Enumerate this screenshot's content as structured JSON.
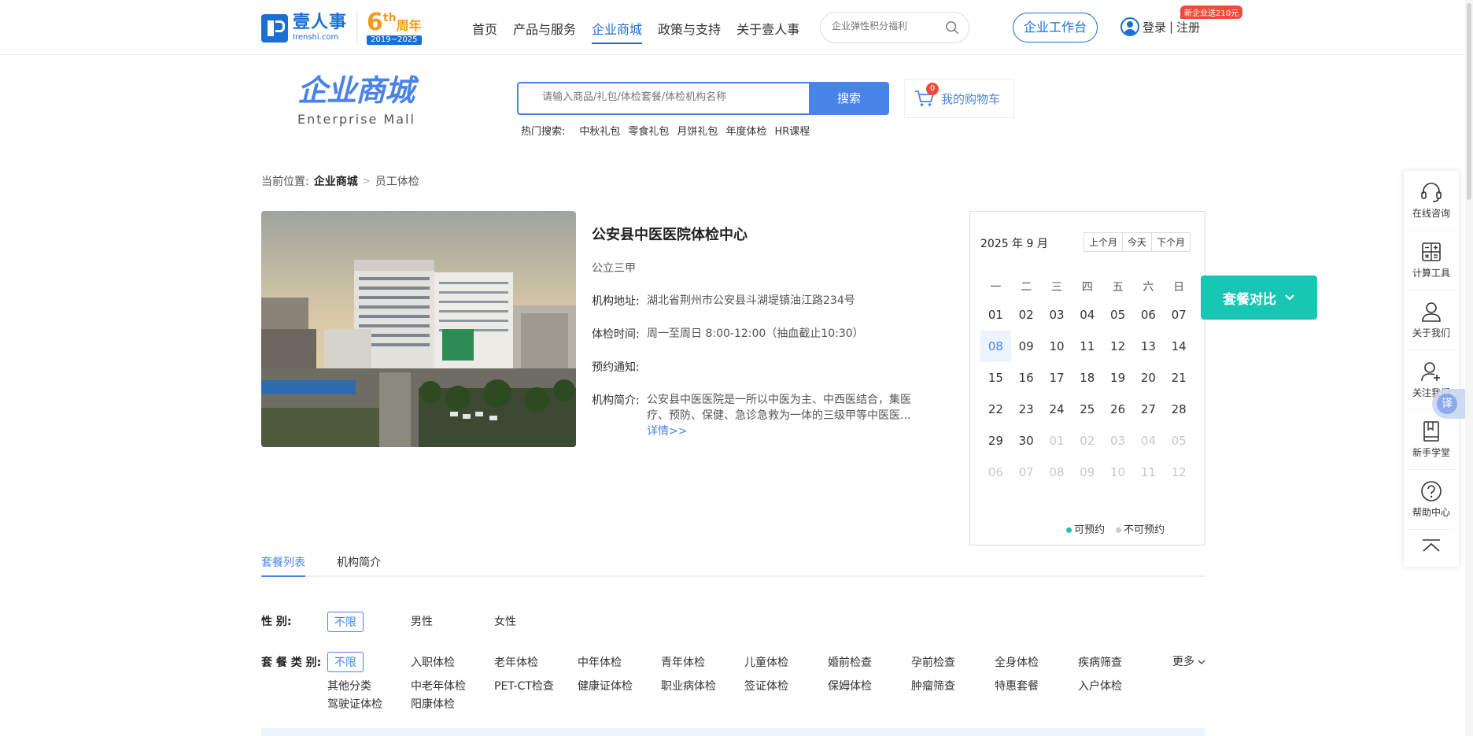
{
  "nav": {
    "logo_cn": "壹人事",
    "logo_en": "Irenshi.com",
    "anniv_big": "6",
    "anniv_sup": "th",
    "anniv_cn": "周年",
    "anniv_years": "2019~2025",
    "items": [
      "首页",
      "产品与服务",
      "企业商城",
      "政策与支持",
      "关于壹人事"
    ],
    "active_item": "企业商城",
    "search_placeholder": "企业弹性积分福利",
    "workbench": "企业工作台",
    "login": "登录",
    "divider": "|",
    "register": "注册",
    "promo": "新企业送210元"
  },
  "mall": {
    "title_cn": "企业商城",
    "title_en": "Enterprise  Mall",
    "search_placeholder": "请输入商品/礼包/体检套餐/体检机构名称",
    "search_button": "搜索",
    "hot_label": "热门搜索:",
    "hot_items": [
      "中秋礼包",
      "零食礼包",
      "月饼礼包",
      "年度体检",
      "HR课程"
    ],
    "cart_label": "我的购物车",
    "cart_count": "0"
  },
  "breadcrumb": {
    "prefix": "当前位置:",
    "level1": "企业商城",
    "sep": ">",
    "level2": "员工体检"
  },
  "institution": {
    "name": "公安县中医医院体检中心",
    "grade": "公立三甲",
    "address_label": "机构地址:",
    "address": "湖北省荆州市公安县斗湖堤镇油江路234号",
    "hours_label": "体检时间:",
    "hours": "周一至周日 8:00-12:00（抽血截止10:30）",
    "notice_label": "预约通知:",
    "notice": "",
    "intro_label": "机构简介:",
    "intro": "公安县中医医院是一所以中医为主、中西医结合，集医疗、预防、保健、急诊急救为一体的三级甲等中医医...",
    "detail_link": "详情>>"
  },
  "calendar": {
    "month_label": "2025 年 9 月",
    "prev": "上个月",
    "today": "今天",
    "next": "下个月",
    "weekdays": [
      "一",
      "二",
      "三",
      "四",
      "五",
      "六",
      "日"
    ],
    "weeks": [
      [
        "01",
        "02",
        "03",
        "04",
        "05",
        "06",
        "07"
      ],
      [
        "08",
        "09",
        "10",
        "11",
        "12",
        "13",
        "14"
      ],
      [
        "15",
        "16",
        "17",
        "18",
        "19",
        "20",
        "21"
      ],
      [
        "22",
        "23",
        "24",
        "25",
        "26",
        "27",
        "28"
      ],
      [
        "29",
        "30",
        "01",
        "02",
        "03",
        "04",
        "05"
      ],
      [
        "06",
        "07",
        "08",
        "09",
        "10",
        "11",
        "12"
      ]
    ],
    "legend_available": "可预约",
    "legend_unavailable": "不可预约",
    "color_available": "#19c5b3",
    "color_unavailable": "#cccccc"
  },
  "compare_button": "套餐对比",
  "sidebar": {
    "items": [
      "在线咨询",
      "计算工具",
      "关于我们",
      "关注我们",
      "新手学堂",
      "帮助中心"
    ],
    "translate": "译"
  },
  "tabs": [
    "套餐列表",
    "机构简介"
  ],
  "filters": {
    "gender_label": "性    别:",
    "gender_options": [
      "不限",
      "男性",
      "女性"
    ],
    "type_label": "套 餐 类 别:",
    "type_options_row1": [
      "不限",
      "入职体检",
      "老年体检",
      "中年体检",
      "青年体检",
      "儿童体检",
      "婚前检查",
      "孕前检查",
      "全身体检",
      "疾病筛查"
    ],
    "type_options_row2": [
      "其他分类",
      "中老年体检",
      "PET-CT检查",
      "健康证体检",
      "职业病体检",
      "签证体检",
      "保姆体检",
      "肿瘤筛查",
      "特惠套餐",
      "入户体检"
    ],
    "type_options_row3": [
      "驾驶证体检",
      "阳康体检"
    ],
    "more": "更多"
  },
  "colors": {
    "brand": "#1a6fd1",
    "accent": "#4a83e8",
    "compare": "#19c5b3",
    "promo": "#f04b3a"
  }
}
